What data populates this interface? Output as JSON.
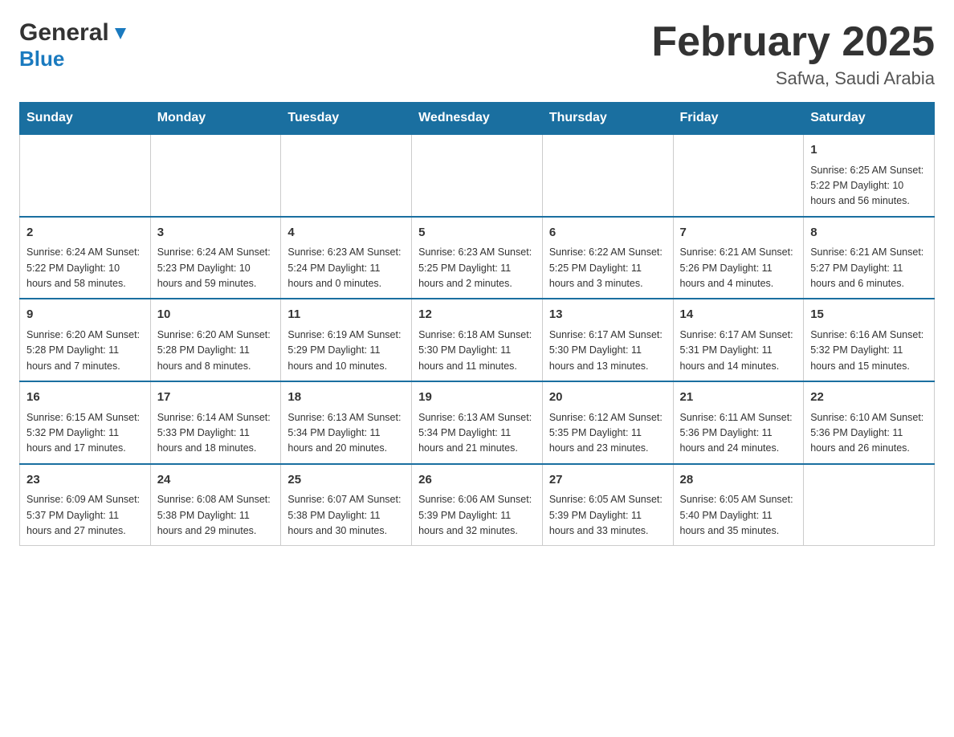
{
  "header": {
    "title": "February 2025",
    "location": "Safwa, Saudi Arabia"
  },
  "logo": {
    "general": "General",
    "blue": "Blue"
  },
  "days": [
    "Sunday",
    "Monday",
    "Tuesday",
    "Wednesday",
    "Thursday",
    "Friday",
    "Saturday"
  ],
  "weeks": [
    {
      "cells": [
        {
          "day": "",
          "info": ""
        },
        {
          "day": "",
          "info": ""
        },
        {
          "day": "",
          "info": ""
        },
        {
          "day": "",
          "info": ""
        },
        {
          "day": "",
          "info": ""
        },
        {
          "day": "",
          "info": ""
        },
        {
          "day": "1",
          "info": "Sunrise: 6:25 AM\nSunset: 5:22 PM\nDaylight: 10 hours\nand 56 minutes."
        }
      ]
    },
    {
      "cells": [
        {
          "day": "2",
          "info": "Sunrise: 6:24 AM\nSunset: 5:22 PM\nDaylight: 10 hours\nand 58 minutes."
        },
        {
          "day": "3",
          "info": "Sunrise: 6:24 AM\nSunset: 5:23 PM\nDaylight: 10 hours\nand 59 minutes."
        },
        {
          "day": "4",
          "info": "Sunrise: 6:23 AM\nSunset: 5:24 PM\nDaylight: 11 hours\nand 0 minutes."
        },
        {
          "day": "5",
          "info": "Sunrise: 6:23 AM\nSunset: 5:25 PM\nDaylight: 11 hours\nand 2 minutes."
        },
        {
          "day": "6",
          "info": "Sunrise: 6:22 AM\nSunset: 5:25 PM\nDaylight: 11 hours\nand 3 minutes."
        },
        {
          "day": "7",
          "info": "Sunrise: 6:21 AM\nSunset: 5:26 PM\nDaylight: 11 hours\nand 4 minutes."
        },
        {
          "day": "8",
          "info": "Sunrise: 6:21 AM\nSunset: 5:27 PM\nDaylight: 11 hours\nand 6 minutes."
        }
      ]
    },
    {
      "cells": [
        {
          "day": "9",
          "info": "Sunrise: 6:20 AM\nSunset: 5:28 PM\nDaylight: 11 hours\nand 7 minutes."
        },
        {
          "day": "10",
          "info": "Sunrise: 6:20 AM\nSunset: 5:28 PM\nDaylight: 11 hours\nand 8 minutes."
        },
        {
          "day": "11",
          "info": "Sunrise: 6:19 AM\nSunset: 5:29 PM\nDaylight: 11 hours\nand 10 minutes."
        },
        {
          "day": "12",
          "info": "Sunrise: 6:18 AM\nSunset: 5:30 PM\nDaylight: 11 hours\nand 11 minutes."
        },
        {
          "day": "13",
          "info": "Sunrise: 6:17 AM\nSunset: 5:30 PM\nDaylight: 11 hours\nand 13 minutes."
        },
        {
          "day": "14",
          "info": "Sunrise: 6:17 AM\nSunset: 5:31 PM\nDaylight: 11 hours\nand 14 minutes."
        },
        {
          "day": "15",
          "info": "Sunrise: 6:16 AM\nSunset: 5:32 PM\nDaylight: 11 hours\nand 15 minutes."
        }
      ]
    },
    {
      "cells": [
        {
          "day": "16",
          "info": "Sunrise: 6:15 AM\nSunset: 5:32 PM\nDaylight: 11 hours\nand 17 minutes."
        },
        {
          "day": "17",
          "info": "Sunrise: 6:14 AM\nSunset: 5:33 PM\nDaylight: 11 hours\nand 18 minutes."
        },
        {
          "day": "18",
          "info": "Sunrise: 6:13 AM\nSunset: 5:34 PM\nDaylight: 11 hours\nand 20 minutes."
        },
        {
          "day": "19",
          "info": "Sunrise: 6:13 AM\nSunset: 5:34 PM\nDaylight: 11 hours\nand 21 minutes."
        },
        {
          "day": "20",
          "info": "Sunrise: 6:12 AM\nSunset: 5:35 PM\nDaylight: 11 hours\nand 23 minutes."
        },
        {
          "day": "21",
          "info": "Sunrise: 6:11 AM\nSunset: 5:36 PM\nDaylight: 11 hours\nand 24 minutes."
        },
        {
          "day": "22",
          "info": "Sunrise: 6:10 AM\nSunset: 5:36 PM\nDaylight: 11 hours\nand 26 minutes."
        }
      ]
    },
    {
      "cells": [
        {
          "day": "23",
          "info": "Sunrise: 6:09 AM\nSunset: 5:37 PM\nDaylight: 11 hours\nand 27 minutes."
        },
        {
          "day": "24",
          "info": "Sunrise: 6:08 AM\nSunset: 5:38 PM\nDaylight: 11 hours\nand 29 minutes."
        },
        {
          "day": "25",
          "info": "Sunrise: 6:07 AM\nSunset: 5:38 PM\nDaylight: 11 hours\nand 30 minutes."
        },
        {
          "day": "26",
          "info": "Sunrise: 6:06 AM\nSunset: 5:39 PM\nDaylight: 11 hours\nand 32 minutes."
        },
        {
          "day": "27",
          "info": "Sunrise: 6:05 AM\nSunset: 5:39 PM\nDaylight: 11 hours\nand 33 minutes."
        },
        {
          "day": "28",
          "info": "Sunrise: 6:05 AM\nSunset: 5:40 PM\nDaylight: 11 hours\nand 35 minutes."
        },
        {
          "day": "",
          "info": ""
        }
      ]
    }
  ]
}
